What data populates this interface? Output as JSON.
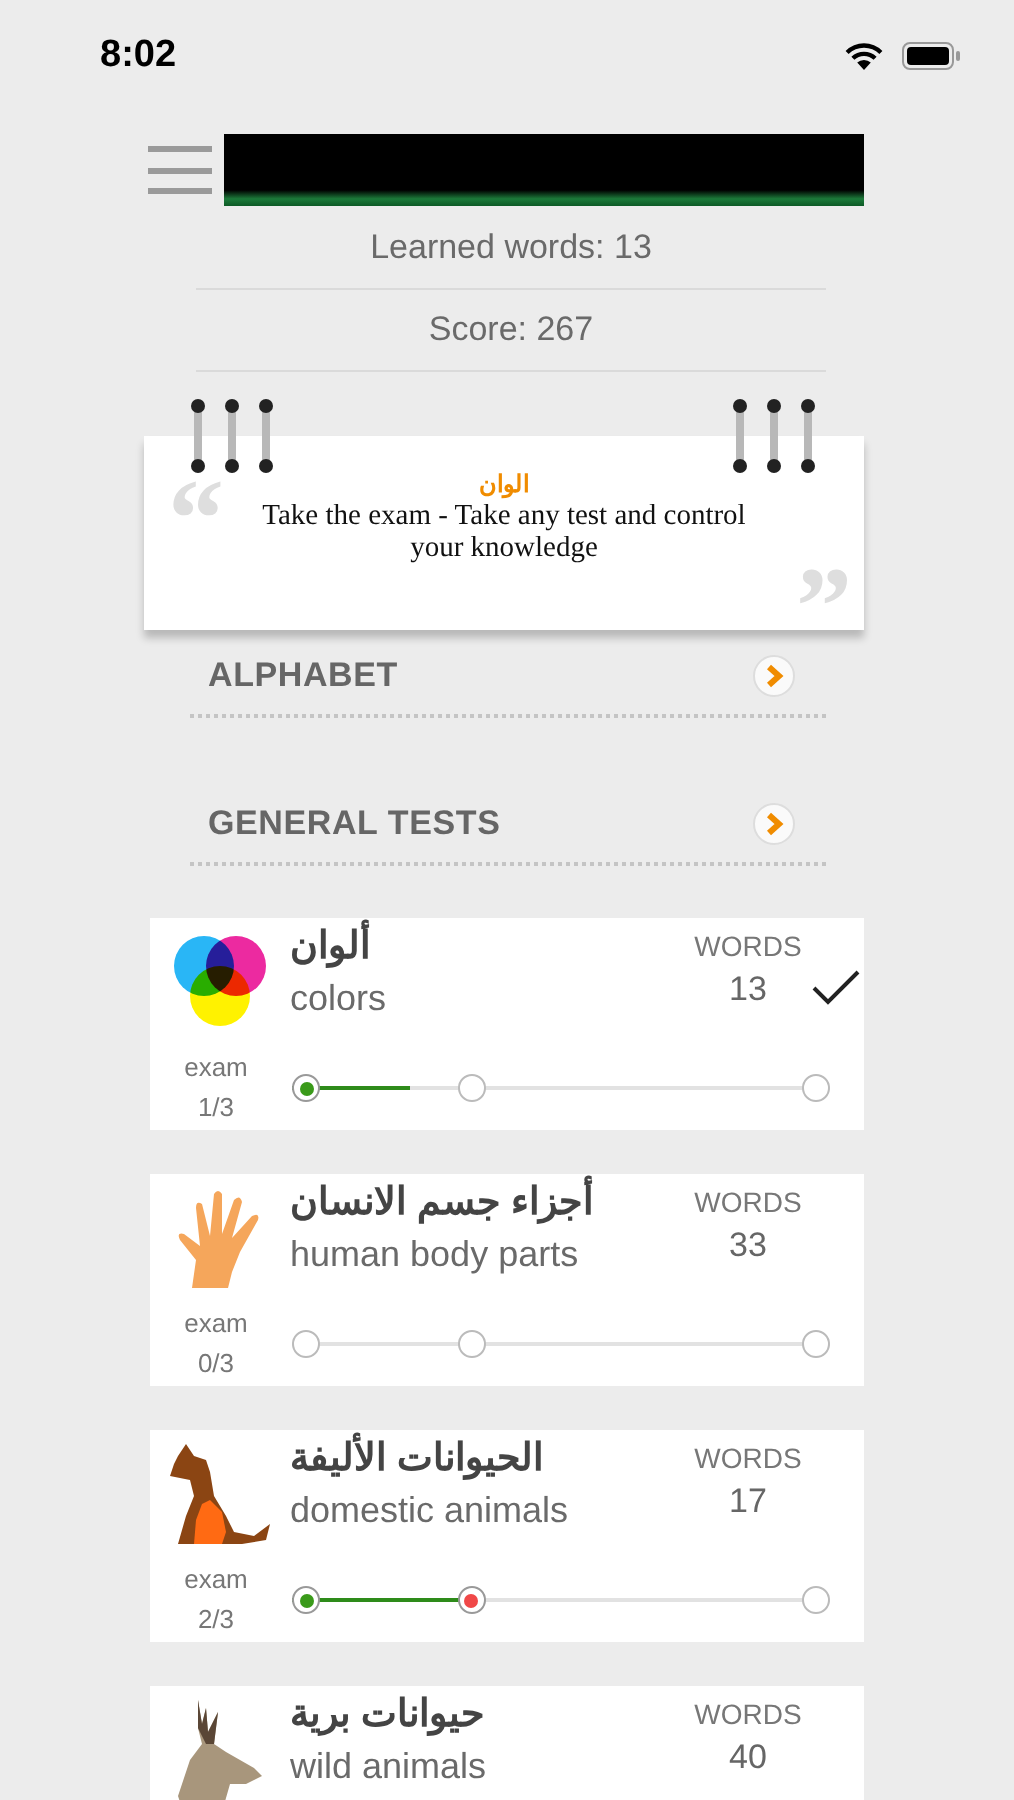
{
  "status_bar": {
    "time": "8:02"
  },
  "stats": [
    {
      "text": "Learned words: 13"
    },
    {
      "text": "Score: 267"
    }
  ],
  "note": {
    "title": "الوان",
    "text": "Take the exam - Take any test and control your knowledge",
    "quote_open": "“",
    "quote_close": "”"
  },
  "sections": [
    {
      "label": "ALPHABET"
    },
    {
      "label": "GENERAL TESTS"
    }
  ],
  "topics": [
    {
      "arabic": "ألوان",
      "english": "colors",
      "words_label": "WORDS",
      "words": "13",
      "completed": true,
      "exam": "exam",
      "exam_count": "1/3",
      "level": 0.22,
      "steps": [
        {
          "passed": true,
          "failed": false
        },
        {
          "passed": false,
          "failed": false
        },
        {
          "passed": false,
          "failed": false
        }
      ]
    },
    {
      "arabic": "أجزاء جسم الانسان",
      "english": "human body parts",
      "words_label": "WORDS",
      "words": "33",
      "completed": false,
      "exam": "exam",
      "exam_count": "0/3",
      "steps": [
        {
          "passed": false,
          "failed": false
        },
        {
          "passed": false,
          "failed": false
        },
        {
          "passed": false,
          "failed": false
        }
      ]
    },
    {
      "arabic": "الحيوانات الأليفة",
      "english": "domestic animals",
      "words_label": "WORDS",
      "words": "17",
      "completed": false,
      "exam": "exam",
      "exam_count": "2/3",
      "level": 0.335,
      "steps": [
        {
          "passed": true,
          "failed": false
        },
        {
          "passed": false,
          "failed": true
        },
        {
          "passed": false,
          "failed": false
        }
      ]
    },
    {
      "arabic": "حيوانات برية",
      "english": "wild animals",
      "words_label": "WORDS",
      "words": "40",
      "completed": false
    }
  ]
}
